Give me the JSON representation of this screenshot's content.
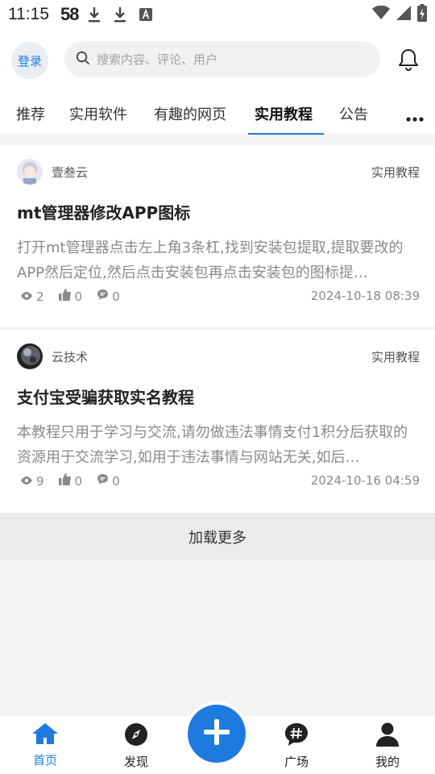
{
  "status_bar": {
    "time": "11:15",
    "network": "58",
    "icons": [
      "download-icon",
      "download-icon",
      "a-box-icon",
      "wifi-icon",
      "signal-icon",
      "battery-charging-icon"
    ]
  },
  "header": {
    "login_label": "登录",
    "search_placeholder": "搜索内容、评论、用户",
    "icons": [
      "search-icon",
      "bell-icon"
    ]
  },
  "tabs": [
    {
      "label": "推荐",
      "active": false
    },
    {
      "label": "实用软件",
      "active": false
    },
    {
      "label": "有趣的网页",
      "active": false
    },
    {
      "label": "实用教程",
      "active": true
    },
    {
      "label": "公告",
      "active": false
    }
  ],
  "posts": [
    {
      "author": "壹叁云",
      "category": "实用教程",
      "title": "mt管理器修改APP图标",
      "excerpt": "打开mt管理器点击左上角3条杠,找到安装包提取,提取要改的APP然后定位,然后点击安装包再点击安装包的图标提…",
      "views": "2",
      "likes": "0",
      "comments": "0",
      "date": "2024-10-18 08:39"
    },
    {
      "author": "云技术",
      "category": "实用教程",
      "title": "支付宝受骗获取实名教程",
      "excerpt": "本教程只用于学习与交流,请勿做违法事情支付1积分后获取的资源用于交流学习,如用于违法事情与网站无关,如后…",
      "views": "9",
      "likes": "0",
      "comments": "0",
      "date": "2024-10-16 04:59"
    }
  ],
  "load_more": "加载更多",
  "bottom_nav": [
    {
      "label": "首页",
      "icon": "home-icon",
      "active": true
    },
    {
      "label": "发现",
      "icon": "compass-icon",
      "active": false
    },
    {
      "label": "广场",
      "icon": "hashtag-chat-icon",
      "active": false
    },
    {
      "label": "我的",
      "icon": "user-icon",
      "active": false
    }
  ],
  "colors": {
    "accent": "#1f7ae0",
    "background": "#f3f3f3"
  }
}
